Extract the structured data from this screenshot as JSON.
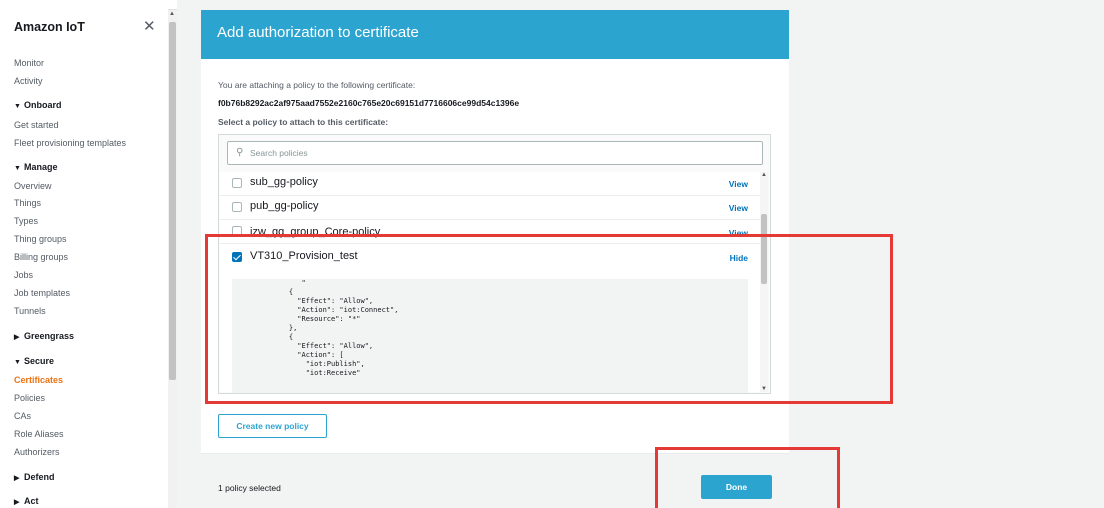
{
  "sidebar": {
    "title": "Amazon IoT",
    "close_icon": "close-icon",
    "items": [
      {
        "label": "Monitor",
        "type": "link"
      },
      {
        "label": "Activity",
        "type": "link"
      },
      {
        "label": "Onboard",
        "type": "section",
        "expanded": true
      },
      {
        "label": "Get started",
        "type": "link"
      },
      {
        "label": "Fleet provisioning templates",
        "type": "link"
      },
      {
        "label": "Manage",
        "type": "section",
        "expanded": true
      },
      {
        "label": "Overview",
        "type": "link"
      },
      {
        "label": "Things",
        "type": "link"
      },
      {
        "label": "Types",
        "type": "link"
      },
      {
        "label": "Thing groups",
        "type": "link"
      },
      {
        "label": "Billing groups",
        "type": "link"
      },
      {
        "label": "Jobs",
        "type": "link"
      },
      {
        "label": "Job templates",
        "type": "link"
      },
      {
        "label": "Tunnels",
        "type": "link"
      },
      {
        "label": "Greengrass",
        "type": "section",
        "expanded": false
      },
      {
        "label": "Secure",
        "type": "section",
        "expanded": true
      },
      {
        "label": "Certificates",
        "type": "link",
        "active": true
      },
      {
        "label": "Policies",
        "type": "link"
      },
      {
        "label": "CAs",
        "type": "link"
      },
      {
        "label": "Role Aliases",
        "type": "link"
      },
      {
        "label": "Authorizers",
        "type": "link"
      },
      {
        "label": "Defend",
        "type": "section",
        "expanded": false
      },
      {
        "label": "Act",
        "type": "section",
        "expanded": false
      }
    ],
    "triangle_down": "▼",
    "triangle_right": "▶"
  },
  "modal": {
    "title": "Add authorization to certificate",
    "attaching_text": "You are attaching a policy to the following certificate:",
    "certificate_id": "f0b76b8292ac2af975aad7552e2160c765e20c69151d7716606ce99d54c1396e",
    "select_text": "Select a policy to attach to this certificate:",
    "search": {
      "placeholder": "Search policies",
      "value": "",
      "icon": "search-icon"
    },
    "policies": [
      {
        "name": "sub_gg-policy",
        "checked": false,
        "action": "View"
      },
      {
        "name": "pub_gg-policy",
        "checked": false,
        "action": "View"
      },
      {
        "name": "izw_gg_group_Core-policy",
        "checked": false,
        "action": "View"
      },
      {
        "name": "VT310_Provision_test",
        "checked": true,
        "action": "Hide"
      }
    ],
    "policy_json": "       \"\n    {\n      \"Effect\": \"Allow\",\n      \"Action\": \"iot:Connect\",\n      \"Resource\": \"*\"\n    },\n    {\n      \"Effect\": \"Allow\",\n      \"Action\": [\n        \"iot:Publish\",\n        \"iot:Receive\"",
    "create_button": "Create new policy",
    "footer_status": "1 policy selected",
    "done_button": "Done"
  },
  "colors": {
    "header": "#2ba4d0",
    "active_nav": "#ec7211",
    "link": "#0073bb",
    "highlight": "#e53935"
  }
}
